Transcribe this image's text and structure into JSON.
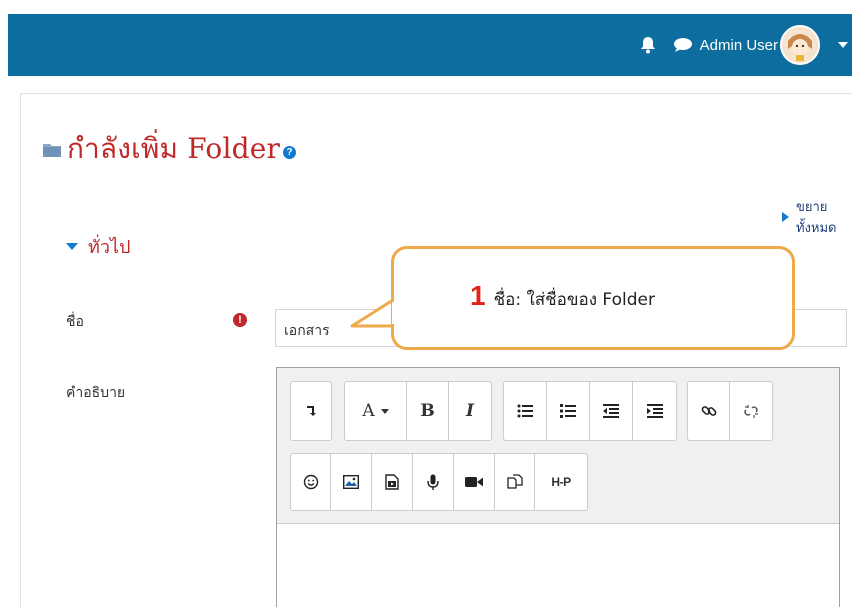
{
  "header": {
    "user_name": "Admin User",
    "brand_color": "#0c6d9e",
    "icons": [
      "bell-icon",
      "chat-icon",
      "avatar",
      "caret-down-icon"
    ]
  },
  "page": {
    "title": "กำลังเพิ่ม Folder",
    "expand_all": "ขยายทั้งหมด",
    "section": "ทั่วไป"
  },
  "form": {
    "name_label": "ชื่อ",
    "name_value": "เอกสาร",
    "description_label": "คำอธิบาย"
  },
  "callout": {
    "number": "1",
    "text": "ชื่อ: ใส่ชื่อของ Folder"
  },
  "editor": {
    "toolbar_row1": [
      "collapse",
      "font-color",
      "bold",
      "italic",
      "unordered-list",
      "ordered-list",
      "outdent",
      "indent",
      "link",
      "unlink"
    ],
    "toolbar_row2": [
      "emoticon",
      "image",
      "media",
      "record-audio",
      "record-video",
      "manage-files",
      "h5p"
    ],
    "h5p_label": "H-P",
    "font_label": "A",
    "bold_label": "B",
    "italic_label": "I"
  },
  "colors": {
    "title": "#c0282a",
    "accent": "#1177d1",
    "callout_border": "#f0a94a",
    "callout_number": "#e2231a"
  }
}
